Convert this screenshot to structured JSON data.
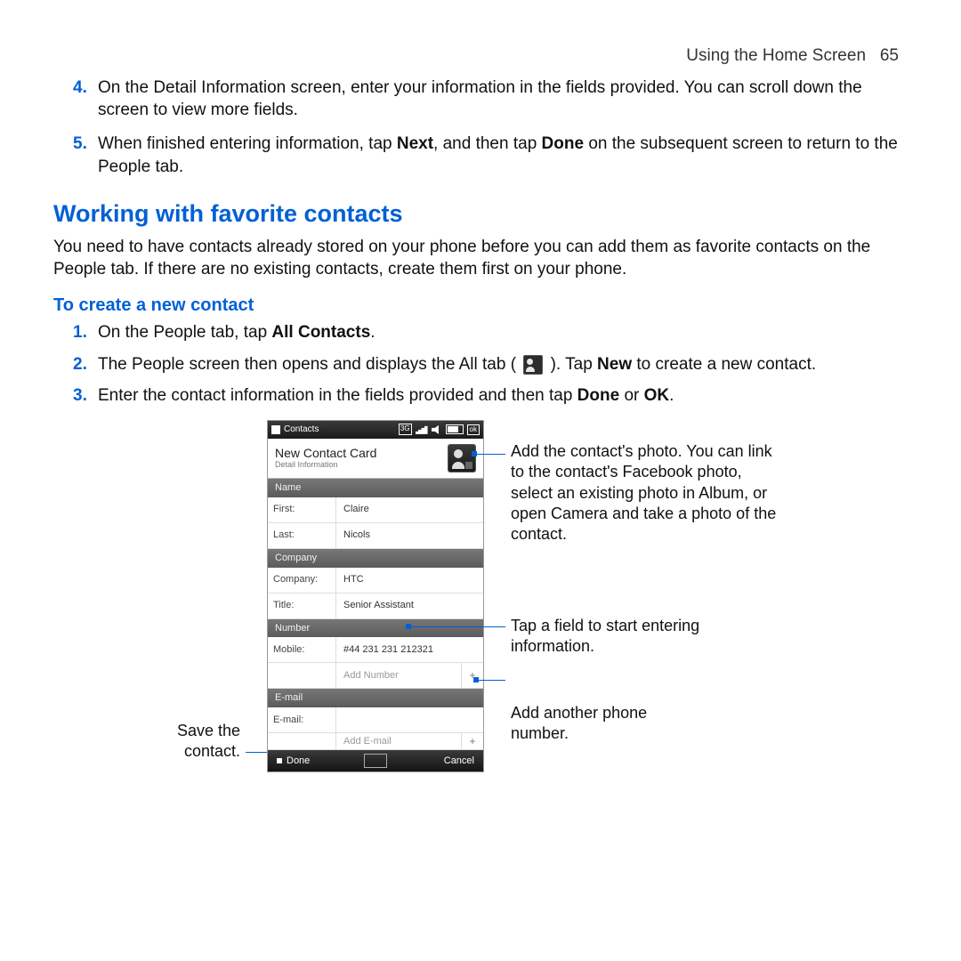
{
  "header": {
    "running": "Using the Home Screen",
    "page": "65"
  },
  "continued": [
    {
      "n": "4.",
      "text": "On the Detail Information screen, enter your information in the fields provided. You can scroll down the screen to view more fields."
    },
    {
      "n": "5.",
      "pre": "When finished entering information, tap ",
      "b1": "Next",
      "mid": ", and then tap ",
      "b2": "Done",
      "post": " on the subsequent screen to return to the People tab."
    }
  ],
  "section_title": "Working with favorite contacts",
  "section_body": "You need to have contacts already stored on your phone before you can add them as favorite contacts on the People tab. If there are no existing contacts, create them first on your phone.",
  "subhead": "To create a new contact",
  "steps": [
    {
      "n": "1.",
      "pre": "On the People tab, tap ",
      "b1": "All Contacts",
      "post": "."
    },
    {
      "n": "2.",
      "pre": "The People screen then opens and displays the All tab ( ",
      "icon": true,
      "mid": " ). Tap ",
      "b1": "New",
      "post": " to create a new contact."
    },
    {
      "n": "3.",
      "pre": "Enter the contact information in the fields provided and then tap ",
      "b1": "Done",
      "mid": " or ",
      "b2": "OK",
      "post": "."
    }
  ],
  "phone": {
    "status_title": "Contacts",
    "status_ok": "ok",
    "card_title": "New Contact Card",
    "card_sub": "Detail Information",
    "groups": {
      "name": "Name",
      "company": "Company",
      "number": "Number",
      "email": "E-mail"
    },
    "fields": {
      "first_lbl": "First:",
      "first_val": "Claire",
      "last_lbl": "Last:",
      "last_val": "Nicols",
      "company_lbl": "Company:",
      "company_val": "HTC",
      "title_lbl": "Title:",
      "title_val": "Senior Assistant",
      "mobile_lbl": "Mobile:",
      "mobile_val": "#44 231 231 212321",
      "addnum": "Add Number",
      "email_lbl": "E-mail:",
      "email_val": "",
      "addemail": "Add E-mail"
    },
    "done": "Done",
    "cancel": "Cancel"
  },
  "annots": {
    "left1": "Save the",
    "left2": "contact.",
    "r1": "Add the contact's photo. You can link to the contact's Facebook photo, select an existing photo in Album, or open Camera and take a photo of the contact.",
    "r2": "Tap a field to start entering information.",
    "r3": "Add another phone number."
  }
}
